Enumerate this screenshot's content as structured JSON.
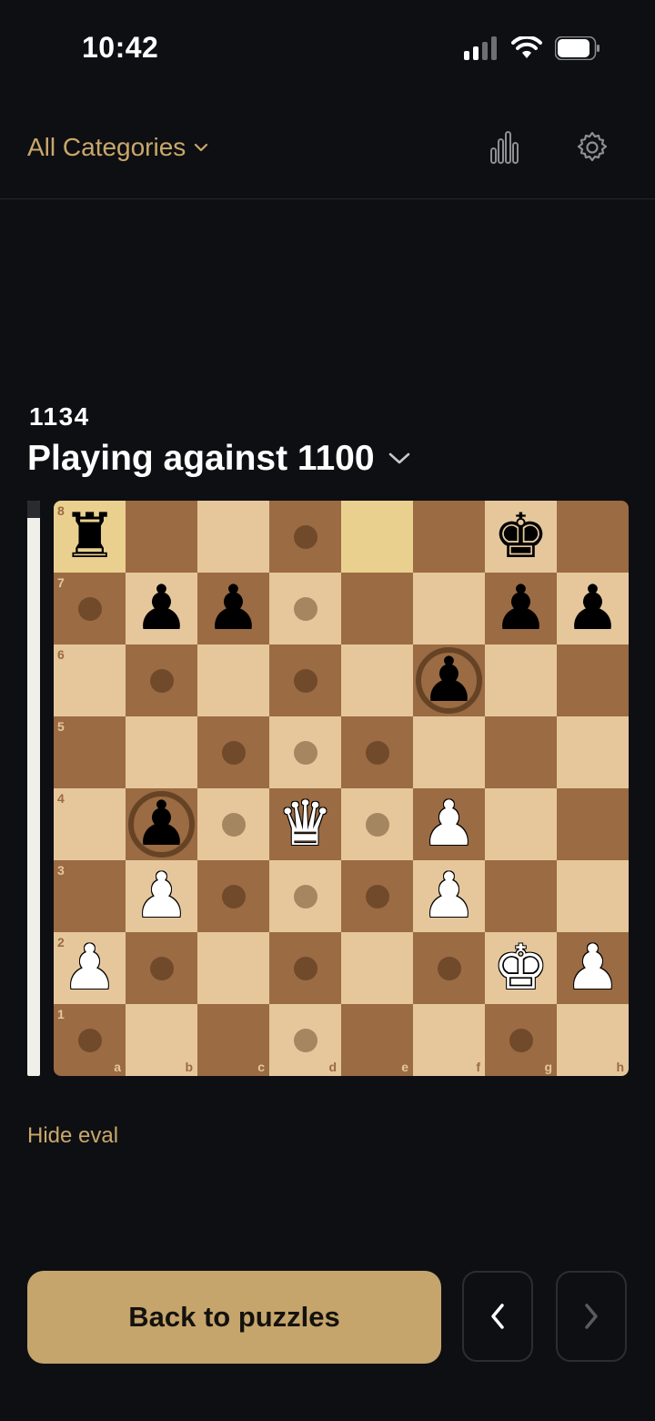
{
  "status_bar": {
    "time": "10:42"
  },
  "header": {
    "category_label": "All Categories",
    "icons": [
      "stats-icon",
      "gear-icon"
    ]
  },
  "puzzle": {
    "rating": "1134",
    "opponent_label": "Playing against 1100"
  },
  "eval_bar": {
    "white_fraction": 0.97
  },
  "board": {
    "files": [
      "a",
      "b",
      "c",
      "d",
      "e",
      "f",
      "g",
      "h"
    ],
    "ranks": [
      "8",
      "7",
      "6",
      "5",
      "4",
      "3",
      "2",
      "1"
    ],
    "pieces": [
      {
        "sq": "a8",
        "piece": "♜",
        "color": "b"
      },
      {
        "sq": "g8",
        "piece": "♚",
        "color": "b"
      },
      {
        "sq": "b7",
        "piece": "♟",
        "color": "b"
      },
      {
        "sq": "c7",
        "piece": "♟",
        "color": "b"
      },
      {
        "sq": "g7",
        "piece": "♟",
        "color": "b"
      },
      {
        "sq": "h7",
        "piece": "♟",
        "color": "b"
      },
      {
        "sq": "f6",
        "piece": "♟",
        "color": "b"
      },
      {
        "sq": "b4",
        "piece": "♟",
        "color": "b"
      },
      {
        "sq": "d4",
        "piece": "♛",
        "color": "w"
      },
      {
        "sq": "f4",
        "piece": "♟",
        "color": "w"
      },
      {
        "sq": "b3",
        "piece": "♟",
        "color": "w"
      },
      {
        "sq": "f3",
        "piece": "♟",
        "color": "w"
      },
      {
        "sq": "a2",
        "piece": "♟",
        "color": "w"
      },
      {
        "sq": "g2",
        "piece": "♚",
        "color": "w"
      },
      {
        "sq": "h2",
        "piece": "♟",
        "color": "w"
      }
    ],
    "highlights": [
      "a8",
      "e8"
    ],
    "move_dots": [
      "d8",
      "a7",
      "d7",
      "b6",
      "d6",
      "c5",
      "d5",
      "e5",
      "c4",
      "e4",
      "c3",
      "d3",
      "e3",
      "b2",
      "d2",
      "f2",
      "a1",
      "d1",
      "g1"
    ],
    "capture_rings": [
      "f6",
      "b4"
    ]
  },
  "controls": {
    "hide_eval_label": "Hide eval",
    "back_label": "Back to puzzles"
  },
  "colors": {
    "accent": "#c5a56c",
    "background": "#0e0f13",
    "light_square": "#e6c79c",
    "dark_square": "#9b6b43"
  }
}
